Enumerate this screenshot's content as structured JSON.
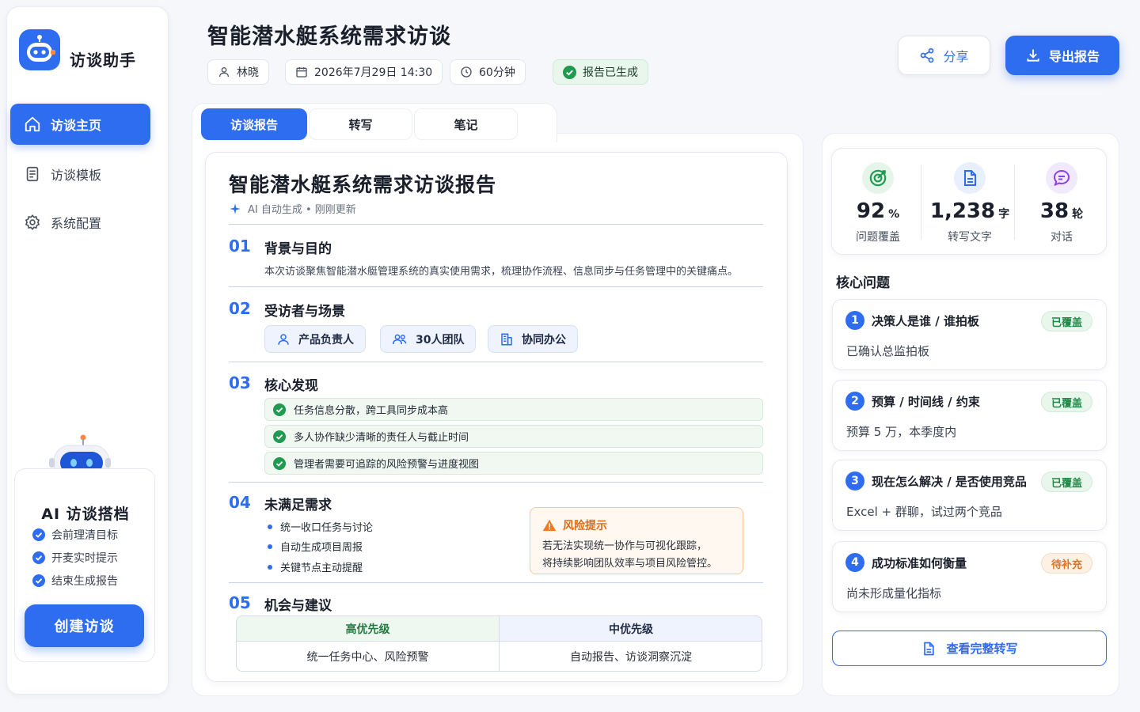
{
  "app": {
    "name": "访谈助手"
  },
  "sidebar": {
    "items": [
      {
        "label": "访谈主页",
        "icon": "home-icon",
        "active": true
      },
      {
        "label": "访谈模板",
        "icon": "document-icon",
        "active": false
      },
      {
        "label": "系统配置",
        "icon": "gear-icon",
        "active": false
      }
    ],
    "ai_card": {
      "title": "AI 访谈搭档",
      "features": [
        "会前理清目标",
        "开麦实时提示",
        "结束生成报告"
      ],
      "create_label": "创建访谈"
    }
  },
  "header": {
    "title": "智能潜水艇系统需求访谈",
    "interviewer": "林晓",
    "datetime": "2026年7月29日 14:30",
    "duration": "60分钟",
    "status": "报告已生成",
    "share_label": "分享",
    "export_label": "导出报告"
  },
  "tabs": [
    {
      "label": "访谈报告",
      "active": true
    },
    {
      "label": "转写",
      "active": false
    },
    {
      "label": "笔记",
      "active": false
    }
  ],
  "report": {
    "title": "智能潜水艇系统需求访谈报告",
    "subtitle": "AI 自动生成 • 刚刚更新",
    "sections": [
      {
        "num": "01",
        "title": "背景与目的",
        "text": "本次访谈聚焦智能潜水艇管理系统的真实使用需求，梳理协作流程、信息同步与任务管理中的关键痛点。"
      },
      {
        "num": "02",
        "title": "受访者与场景",
        "tags": [
          "产品负责人",
          "30人团队",
          "协同办公"
        ]
      },
      {
        "num": "03",
        "title": "核心发现",
        "findings": [
          "任务信息分散，跨工具同步成本高",
          "多人协作缺少清晰的责任人与截止时间",
          "管理者需要可追踪的风险预警与进度视图"
        ]
      },
      {
        "num": "04",
        "title": "未满足需求",
        "bullets": [
          "统一收口任务与讨论",
          "自动生成项目周报",
          "关键节点主动提醒"
        ],
        "risk": {
          "title": "风险提示",
          "lines": [
            "若无法实现统一协作与可视化跟踪，",
            "将持续影响团队效率与项目风险管控。"
          ]
        }
      },
      {
        "num": "05",
        "title": "机会与建议",
        "priorities": [
          {
            "level": "高优先级",
            "items": "统一任务中心、风险预警"
          },
          {
            "level": "中优先级",
            "items": "自动报告、访谈洞察沉淀"
          }
        ]
      }
    ]
  },
  "stats": [
    {
      "value": "92",
      "unit": "%",
      "label": "问题覆盖",
      "icon": "target-icon",
      "color": "#1f9a4e",
      "bg": "#e6f5ea"
    },
    {
      "value": "1,238",
      "unit": "字",
      "label": "转写文字",
      "icon": "file-text-icon",
      "color": "#2f6df0",
      "bg": "#e8effd"
    },
    {
      "value": "38",
      "unit": "轮",
      "label": "对话",
      "icon": "chat-icon",
      "color": "#8a3ff0",
      "bg": "#f1e9fd"
    }
  ],
  "core_questions": {
    "title": "核心问题",
    "items": [
      {
        "num": "1",
        "title": "决策人是谁 / 谁拍板",
        "status": "已覆盖",
        "desc": "已确认总监拍板"
      },
      {
        "num": "2",
        "title": "预算 / 时间线 / 约束",
        "status": "已覆盖",
        "desc": "预算 5 万，本季度内"
      },
      {
        "num": "3",
        "title": "现在怎么解决 / 是否使用竞品",
        "status": "已覆盖",
        "desc": "Excel + 群聊，试过两个竞品"
      },
      {
        "num": "4",
        "title": "成功标准如何衡量",
        "status": "待补充",
        "desc": "尚未形成量化指标"
      }
    ],
    "view_label": "查看完整转写"
  },
  "colors": {
    "accent": "#2f6df0",
    "success": "#1f9a4e",
    "warning": "#e06a14"
  }
}
